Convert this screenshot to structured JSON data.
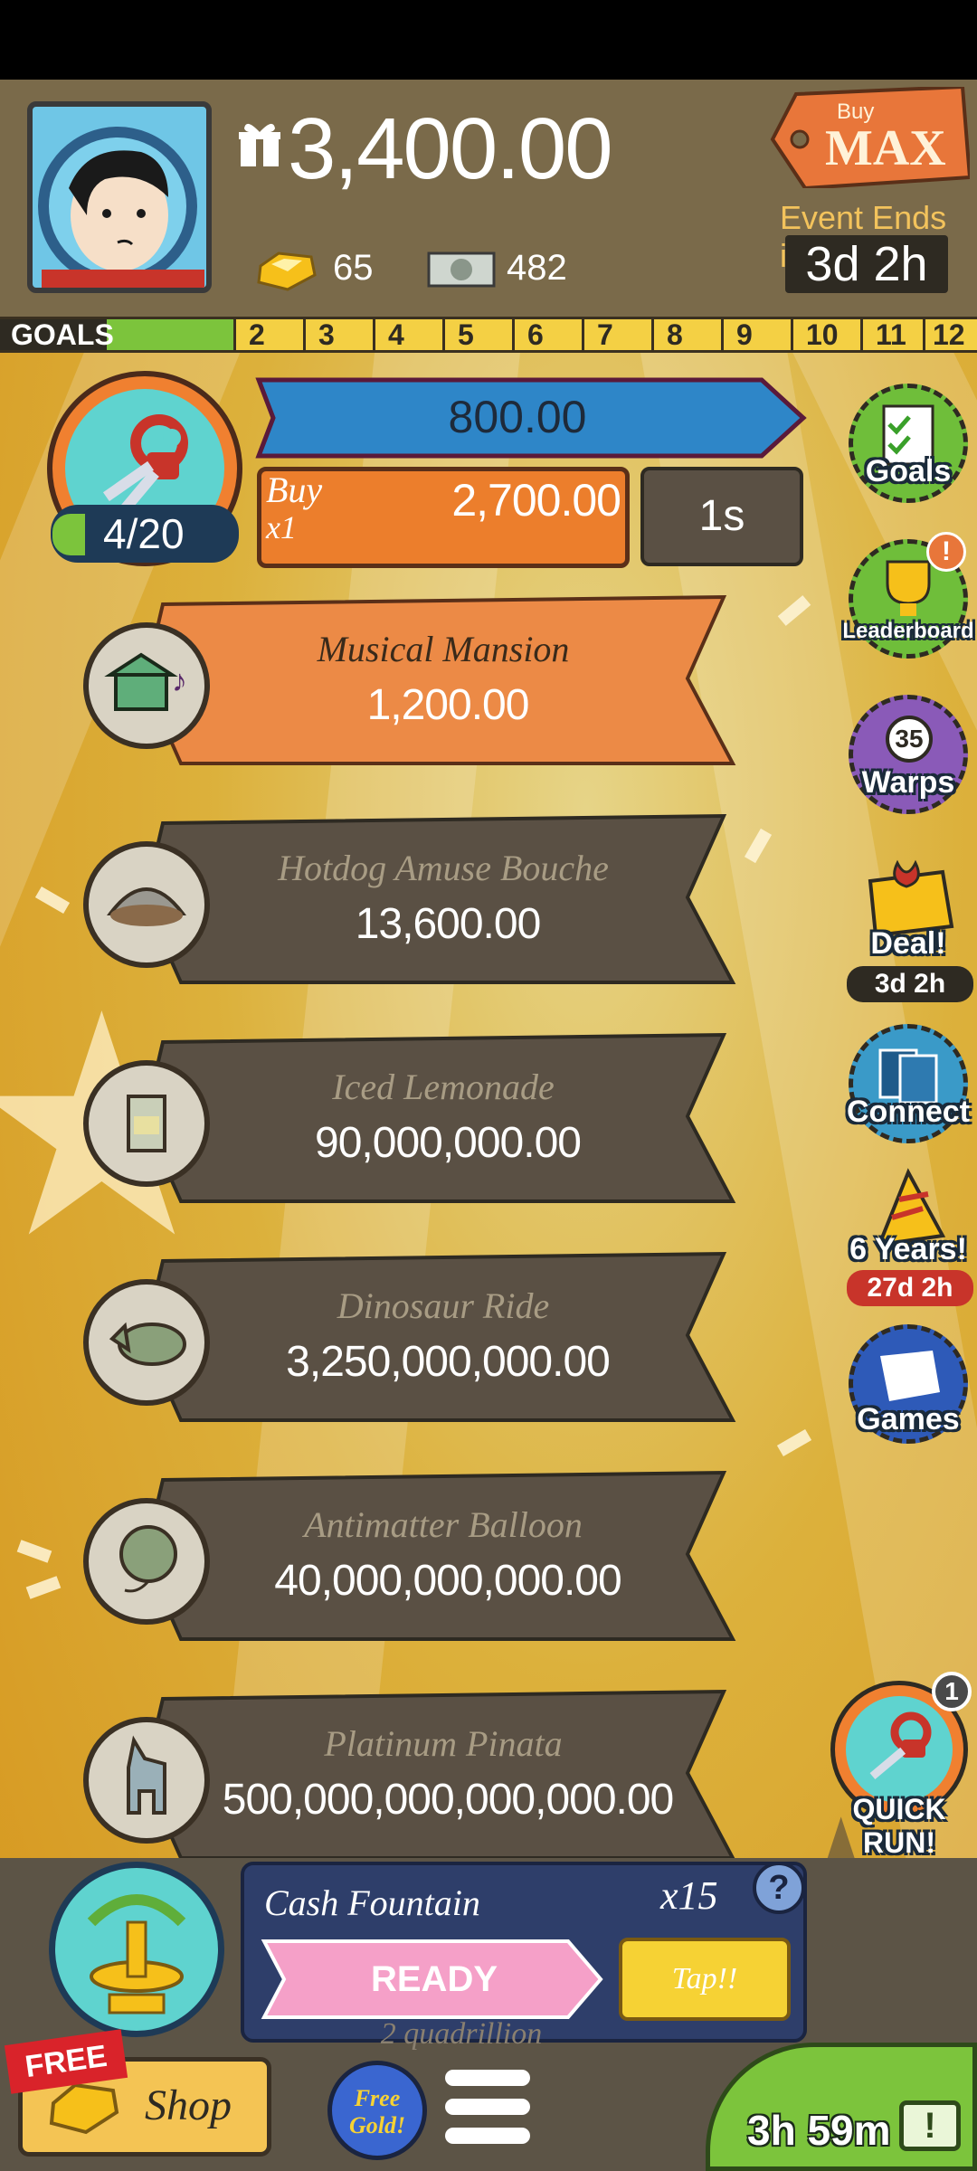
{
  "header": {
    "cash": "3,400.00",
    "gold": "65",
    "megabucks": "482",
    "buy_max_small": "Buy",
    "buy_max_big": "MAX",
    "event_label": "Event Ends in:",
    "event_time": "3d 2h"
  },
  "goals": {
    "label": "GOALS",
    "numbers": [
      "2",
      "3",
      "4",
      "5",
      "6",
      "7",
      "8",
      "9",
      "10",
      "11",
      "12"
    ]
  },
  "upgrade": {
    "count": "4/20",
    "progress_value": "800.00",
    "buy_label": "Buy",
    "buy_mult": "x1",
    "buy_cost": "2,700.00",
    "timer": "1s"
  },
  "businesses": [
    {
      "name": "Musical Mansion",
      "value": "1,200.00",
      "icon": "mansion-icon"
    },
    {
      "name": "Hotdog Amuse Bouche",
      "value": "13,600.00",
      "icon": "hotdog-icon"
    },
    {
      "name": "Iced Lemonade",
      "value": "90,000,000.00",
      "icon": "lemonade-icon"
    },
    {
      "name": "Dinosaur Ride",
      "value": "3,250,000,000.00",
      "icon": "dinosaur-icon"
    },
    {
      "name": "Antimatter Balloon",
      "value": "40,000,000,000.00",
      "icon": "balloon-icon"
    },
    {
      "name": "Platinum Pinata",
      "value": "500,000,000,000,000.00",
      "icon": "pinata-icon"
    }
  ],
  "side_menu": {
    "goals": "Goals",
    "leaderboard": "Leaderboard",
    "warps_count": "35",
    "warps": "Warps",
    "deal": "Deal!",
    "deal_time": "3d 2h",
    "connect": "Connect",
    "years": "6 Years!",
    "years_time": "27d 2h",
    "games": "Games"
  },
  "quick_run": {
    "badge": "1",
    "label": "QUICK RUN!"
  },
  "cash_fountain": {
    "title": "Cash Fountain",
    "multiplier": "x15",
    "help": "?",
    "ready": "READY",
    "tap": "Tap!!",
    "below_text": "2 quadrillion"
  },
  "bottom": {
    "free_tag": "FREE",
    "shop": "Shop",
    "free_gold": "Free Gold!",
    "timer": "3h 59m",
    "tv_symbol": "!"
  },
  "colors": {
    "orange": "#ec7e2c",
    "dark_ribbon": "#5a5044",
    "blue_bar": "#2e86c8",
    "green": "#7cc43c",
    "teal": "#5fd3cf"
  }
}
